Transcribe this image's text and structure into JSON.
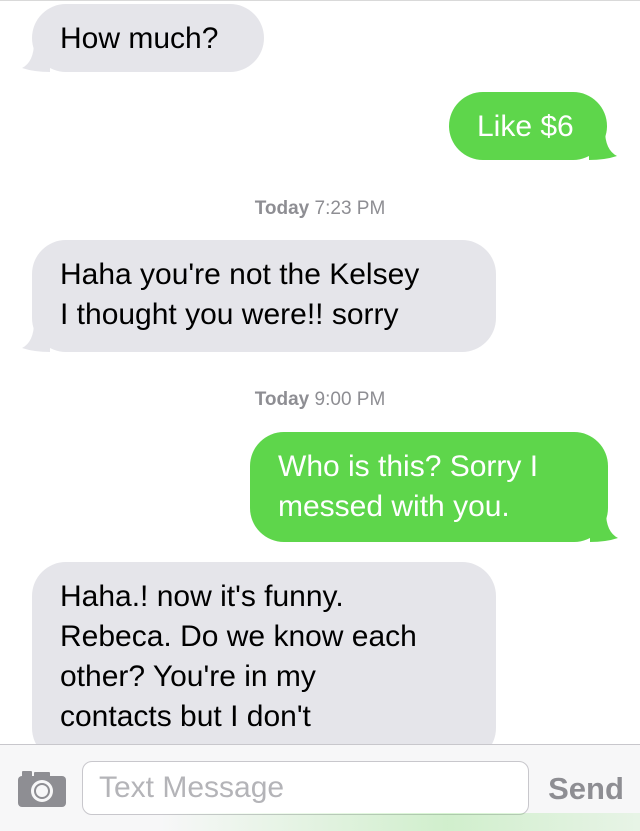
{
  "colors": {
    "incoming_bubble": "#e5e5ea",
    "outgoing_bubble": "#5ed64b",
    "timestamp_text": "#8e8e93",
    "send_label": "#8e8e93"
  },
  "conversation": {
    "messages": [
      {
        "direction": "incoming",
        "lines": [
          "How much?"
        ]
      },
      {
        "direction": "outgoing",
        "lines": [
          "Like $6"
        ]
      },
      {
        "timestamp_day": "Today",
        "timestamp_time": "7:23 PM"
      },
      {
        "direction": "incoming",
        "lines": [
          "Haha you're not the Kelsey",
          "I thought you were!! sorry"
        ]
      },
      {
        "timestamp_day": "Today",
        "timestamp_time": "9:00 PM"
      },
      {
        "direction": "outgoing",
        "lines": [
          "Who is this? Sorry I",
          "messed with you."
        ]
      },
      {
        "direction": "incoming",
        "lines": [
          "Haha.! now it's funny.",
          "Rebeca. Do we know each",
          "other? You're in my",
          "contacts but I don't"
        ]
      }
    ]
  },
  "composer": {
    "camera_icon": "camera-icon",
    "placeholder": "Text Message",
    "send_label": "Send"
  }
}
